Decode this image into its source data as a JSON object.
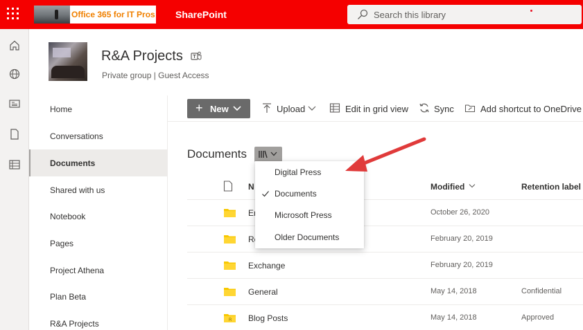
{
  "suitebar": {
    "org_logo_text": "Office 365 for IT Pros",
    "app_name": "SharePoint",
    "search_placeholder": "Search this library",
    "background_color": "#f50000"
  },
  "rail": {
    "icons": [
      "home-icon",
      "globe-icon",
      "news-icon",
      "document-icon",
      "list-icon"
    ]
  },
  "site": {
    "title": "R&A Projects",
    "subtitle": "Private group | Guest Access"
  },
  "leftnav": {
    "items": [
      {
        "label": "Home"
      },
      {
        "label": "Conversations"
      },
      {
        "label": "Documents",
        "selected": true
      },
      {
        "label": "Shared with us"
      },
      {
        "label": "Notebook"
      },
      {
        "label": "Pages"
      },
      {
        "label": "Project Athena"
      },
      {
        "label": "Plan Beta"
      },
      {
        "label": "R&A Projects"
      }
    ]
  },
  "commandbar": {
    "new_label": "New",
    "upload_label": "Upload",
    "grid_label": "Edit in grid view",
    "sync_label": "Sync",
    "shortcut_label": "Add shortcut to OneDrive"
  },
  "library": {
    "title": "Documents"
  },
  "views_dropdown": {
    "items": [
      {
        "label": "Digital Press",
        "checked": false
      },
      {
        "label": "Documents",
        "checked": true
      },
      {
        "label": "Microsoft Press",
        "checked": false
      },
      {
        "label": "Older Documents",
        "checked": false
      }
    ]
  },
  "table": {
    "headers": {
      "name": "N",
      "modified": "Modified",
      "retention": "Retention label"
    },
    "rows": [
      {
        "name": "Er",
        "modified": "October 26, 2020",
        "retention": ""
      },
      {
        "name": "Re",
        "modified": "February 20, 2019",
        "retention": ""
      },
      {
        "name": "Exchange",
        "modified": "February 20, 2019",
        "retention": ""
      },
      {
        "name": "General",
        "modified": "May 14, 2018",
        "retention": "Confidential"
      },
      {
        "name": "Blog Posts",
        "modified": "May 14, 2018",
        "retention": "Approved"
      }
    ]
  },
  "colors": {
    "accent_red": "#f50000",
    "folder_yellow": "#f8c800",
    "annotation_arrow": "#e03a3a"
  }
}
